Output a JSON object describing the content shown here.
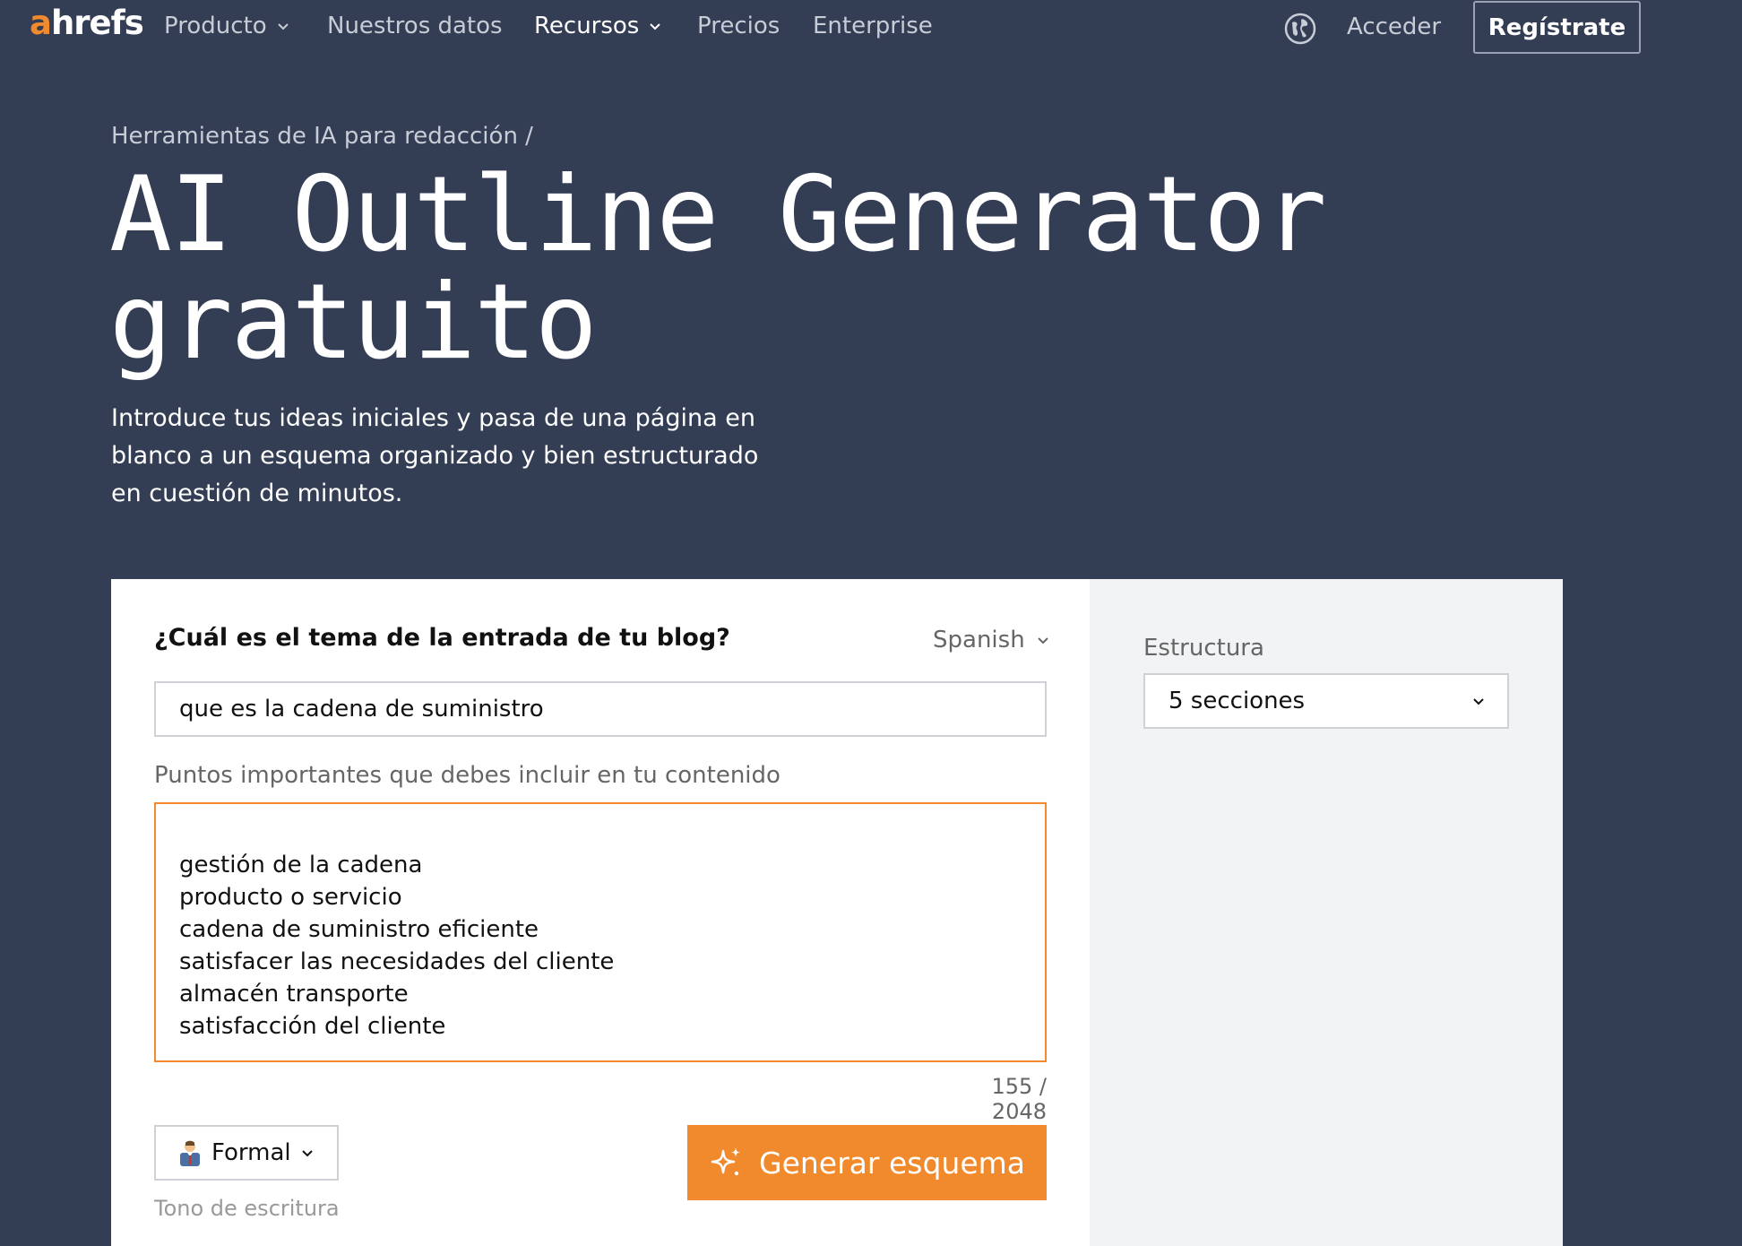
{
  "nav": {
    "logo_prefix": "a",
    "logo_rest": "hrefs",
    "items": [
      {
        "label": "Producto"
      },
      {
        "label": "Nuestros datos"
      },
      {
        "label": "Recursos"
      },
      {
        "label": "Precios"
      },
      {
        "label": "Enterprise"
      }
    ],
    "login": "Acceder",
    "signup": "Regístrate",
    "icons": {
      "globe": "globe-icon",
      "chevron": "chevron-down-icon"
    }
  },
  "hero": {
    "breadcrumb": "Herramientas de IA para redacción /",
    "title_line1": "AI Outline Generator",
    "title_line2": "gratuito",
    "subtitle": "Introduce tus ideas iniciales y pasa de una página en blanco a un esquema organizado y bien estructurado en cuestión de minutos."
  },
  "form": {
    "question": "¿Cuál es el tema de la entrada de tu blog?",
    "language": "Spanish",
    "topic_value": "que es la cadena de suministro",
    "points_label": "Puntos importantes que debes incluir en tu contenido",
    "points": [
      "gestión de la cadena",
      "producto o servicio",
      "cadena de suministro eficiente",
      "satisfacer las necesidades del cliente",
      "almacén transporte",
      "satisfacción del cliente"
    ],
    "counter": "155 / 2048",
    "tone_value": "Formal",
    "tone_label": "Tono de escritura",
    "generate_label": "Generar esquema",
    "structure_label": "Estructura",
    "structure_value": "5 secciones"
  },
  "colors": {
    "background": "#333d54",
    "accent": "#f08a2c",
    "panel": "#f2f3f5"
  }
}
